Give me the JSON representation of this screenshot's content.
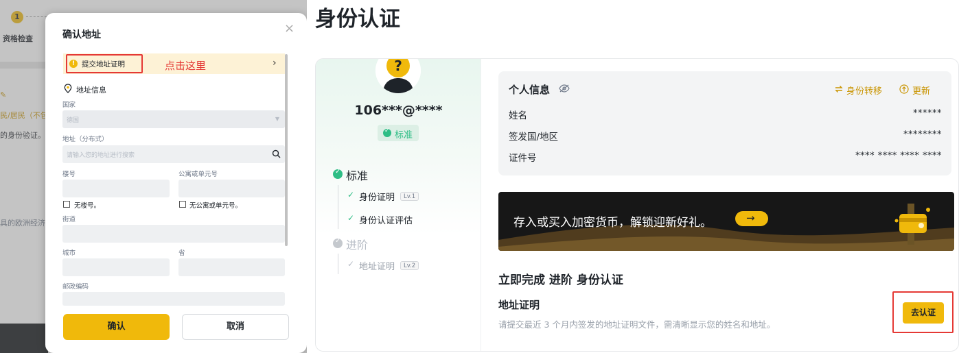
{
  "background": {
    "step_number": "1",
    "step_label": "资格检查",
    "line_edit": "",
    "line_resident": "民/居民（不包",
    "line_verify": "的身份验证。",
    "line_eu": "具的欧洲经济"
  },
  "modal": {
    "title": "确认地址",
    "close_glyph": "×",
    "banner_text": "提交地址证明",
    "annotation": "点击这里",
    "banner_chevron": "›",
    "section_title": "地址信息",
    "country_label": "国家",
    "country_value": "德国",
    "address_label": "地址（分布式）",
    "address_placeholder": "请输入您的地址进行搜索",
    "building_label": "楼号",
    "apartment_label": "公寓或单元号",
    "no_building_label": "无楼号。",
    "no_apartment_label": "无公寓或单元号。",
    "street_label": "街道",
    "city_label": "城市",
    "province_label": "省",
    "postal_label": "邮政编码",
    "confirm_label": "确认",
    "cancel_label": "取消"
  },
  "page": {
    "title": "身份认证",
    "user": {
      "name": "106***@****",
      "badge": "标准"
    },
    "levels": [
      {
        "label": "标准",
        "done": true,
        "items": [
          {
            "label": "身份证明",
            "tag": "Lv.1"
          },
          {
            "label": "身份认证评估",
            "tag": ""
          }
        ]
      },
      {
        "label": "进阶",
        "done": false,
        "items": [
          {
            "label": "地址证明",
            "tag": "Lv.2"
          }
        ]
      }
    ],
    "info": {
      "title": "个人信息",
      "transfer_label": "身份转移",
      "update_label": "更新",
      "rows": [
        {
          "key": "姓名",
          "value": "******"
        },
        {
          "key": "签发国/地区",
          "value": "********"
        },
        {
          "key": "证件号",
          "value": "**** **** **** ****"
        }
      ]
    },
    "promo": {
      "text": "存入或买入加密货币，解锁迎新好礼。",
      "arrow": "→"
    },
    "cta": {
      "title": "立即完成 进阶 身份认证",
      "item_title": "地址证明",
      "item_desc": "请提交最近 3 个月内签发的地址证明文件，需清晰显示您的姓名和地址。",
      "button": "去认证"
    }
  },
  "colors": {
    "accent": "#f0b90b",
    "success": "#2ebd85",
    "highlight_red": "#e53935",
    "link_gold": "#c99400"
  }
}
